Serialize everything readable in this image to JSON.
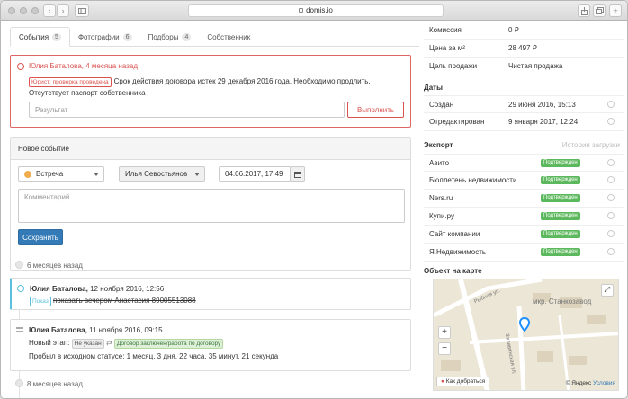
{
  "browser": {
    "url": "domis.io"
  },
  "tabs": [
    {
      "label": "События",
      "count": "5"
    },
    {
      "label": "Фотографии",
      "count": "6"
    },
    {
      "label": "Подборы",
      "count": "4"
    },
    {
      "label": "Собственник",
      "count": ""
    }
  ],
  "alert": {
    "title": "Юлия Баталова, 4 месяца назад",
    "tag": "Юрист: проверка проведена",
    "text": "Срок действия договора истек 29 декабря 2016 года. Необходимо продлить. Отсутствует паспорт собственника",
    "result_placeholder": "Результат",
    "done_button": "Выполнить"
  },
  "new_event": {
    "heading": "Новое событие",
    "type": "Встреча",
    "agent": "Илья Севостьянов",
    "datetime": "04.06.2017, 17:49",
    "comment_placeholder": "Комментарий",
    "save_button": "Сохранить"
  },
  "timeline": {
    "group1": "6 месяцев назад",
    "group2": "8 месяцев назад",
    "event1": {
      "author": "Юлия Баталова,",
      "date": "12 ноября 2016, 12:56",
      "tag": "Показ",
      "text": "показать вечером Анастасия 89005513088"
    },
    "event2": {
      "author": "Юлия Баталова,",
      "date": "11 ноября 2016, 09:15",
      "stage_label": "Новый этап:",
      "from_tag": "Не указан",
      "to_tag": "Договор заключен/работа по договору",
      "duration": "Пробыл в исходном статусе: 1 месяц, 3 дня, 22 часа, 35 минут, 21 секунда"
    }
  },
  "details": {
    "commission_label": "Комиссия",
    "commission_value": "0 ₽",
    "price_label": "Цена за м²",
    "price_value": "28 497 ₽",
    "goal_label": "Цель продажи",
    "goal_value": "Чистая продажа"
  },
  "dates": {
    "heading": "Даты",
    "created_label": "Создан",
    "created_value": "29 июня 2016, 15:13",
    "edited_label": "Отредактирован",
    "edited_value": "9 января 2017, 12:24"
  },
  "export": {
    "heading": "Экспорт",
    "history_link": "История загрузки",
    "items": [
      {
        "name": "Авито",
        "status": "Подтвержден"
      },
      {
        "name": "Бюллетень недвижимости",
        "status": "Подтвержден"
      },
      {
        "name": "Ners.ru",
        "status": "Подтвержден"
      },
      {
        "name": "Купи.ру",
        "status": "Подтвержден"
      },
      {
        "name": "Сайт компании",
        "status": "Подтвержден"
      },
      {
        "name": "Я.Недвижимость",
        "status": "Подтвержден"
      }
    ]
  },
  "map": {
    "heading": "Объект на карте",
    "district": "мкр. Станкозавод",
    "street1": "Рыбная ул.",
    "street2": "Заливинская ул.",
    "route_button": "Как добраться",
    "copyright": "© Яндекс",
    "terms": "Условия"
  },
  "colors": {
    "accent": "#337ab7",
    "danger": "#d9534f",
    "success": "#5cb85c",
    "info": "#5bc0de"
  }
}
